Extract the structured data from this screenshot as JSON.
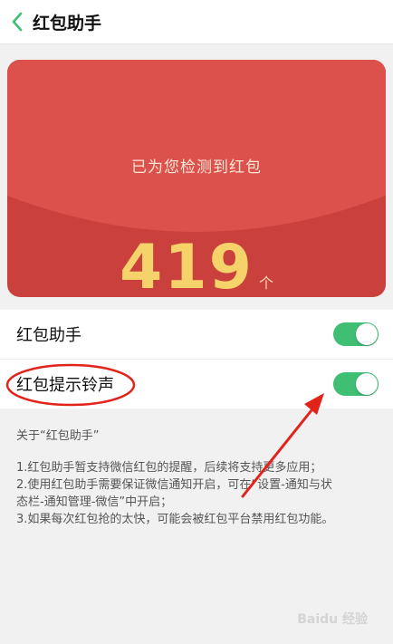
{
  "header": {
    "title": "红包助手"
  },
  "card": {
    "title": "已为您检测到红包",
    "count": "419",
    "unit": "个"
  },
  "settings": [
    {
      "label": "红包助手",
      "on": true
    },
    {
      "label": "红包提示铃声",
      "on": true
    }
  ],
  "about": {
    "heading": "关于“红包助手”",
    "lines": [
      "1.红包助手暂支持微信红包的提醒，后续将支持更多应用；",
      "2.使用红包助手需要保证微信通知开启，可在“设置-通知与状",
      "态栏-通知管理-微信”中开启；",
      "3.如果每次红包抢的太快，可能会被红包平台禁用红包功能。"
    ]
  },
  "watermark": "Baidu 经验",
  "colors": {
    "accent": "#3fbe74",
    "card": "#c9403c",
    "number": "#f6d36a",
    "annotation": "#e2231a"
  }
}
